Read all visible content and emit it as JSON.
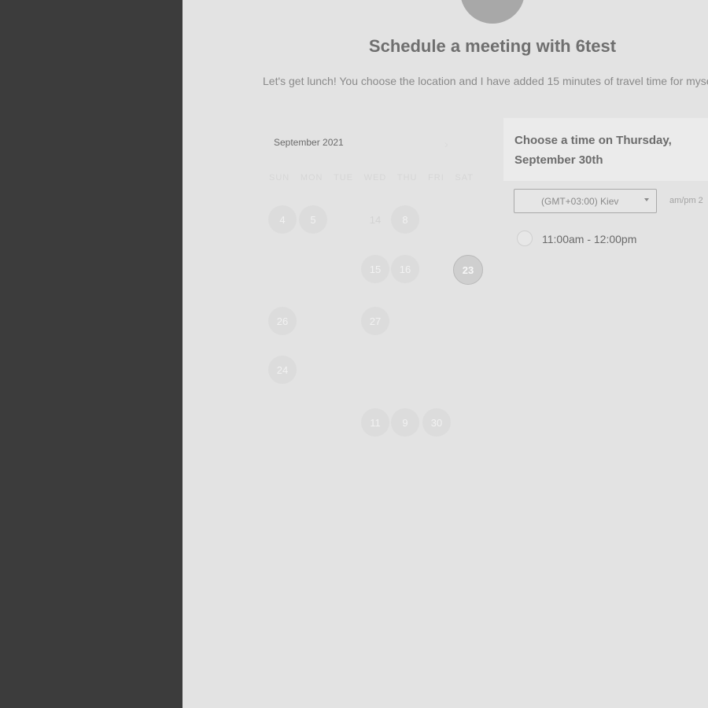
{
  "page": {
    "title": "Schedule a meeting with 6test",
    "subtitle": "Let's get lunch! You choose the location and I have added 15 minutes of travel time for myse"
  },
  "calendar": {
    "month_label": "September 2021",
    "next_icon": "chevron-right-icon",
    "weekdays": [
      "SUN",
      "MON",
      "TUE",
      "WED",
      "THU",
      "FRI",
      "SAT"
    ],
    "days": [
      "4",
      "5",
      "14",
      "8",
      "15",
      "16",
      "23",
      "26",
      "27",
      "24",
      "11",
      "9",
      "30"
    ],
    "selected_day": "23"
  },
  "time_picker": {
    "heading": "Choose a time on Thursday, September 30th",
    "timezone": "(GMT+03:00) Kiev",
    "format_label": "am/pm 2",
    "slots": [
      {
        "label": "11:00am - 12:00pm"
      }
    ]
  },
  "colors": {
    "left_panel": "#3c3c3c",
    "background": "#e3e3e3",
    "avatar": "#a8a8a8"
  }
}
